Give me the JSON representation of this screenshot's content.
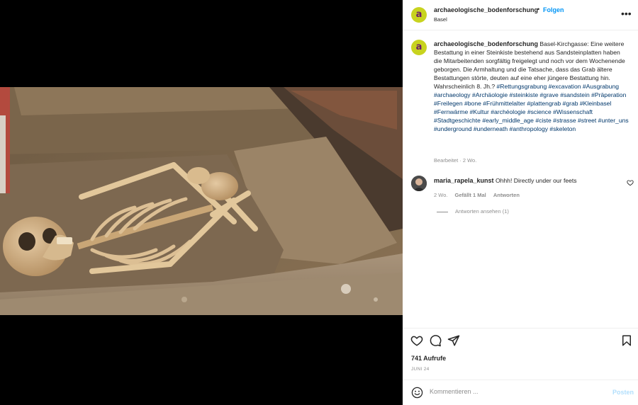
{
  "post": {
    "username": "archaeologische_bodenforschung",
    "avatar_letter": "a",
    "dot": "•",
    "follow_label": "Folgen",
    "location": "Basel",
    "more_label": "•••",
    "caption_text": "Basel-Kirchgasse: Eine weitere Bestattung in einer Steinkiste bestehend aus Sandsteinplatten haben die Mitarbeitenden sorgfältig freigelegt und noch vor dem Wochenende geborgen. Die Armhaltung und die Tatsache, dass das Grab ältere Bestattungen störte, deuten auf eine eher jüngere Bestattung hin. Wahrscheinlich 8. Jh.?",
    "hashtags": "#Rettungsgrabung #excavation #Ausgrabung #archaeology #Archäologie #steinkiste #grave #sandstein #Präperation #Freilegen #bone #Frühmittelalter #plattengrab #grab #Kleinbasel #Fernwärme #Kultur #archéologie #science #Wissenschaft #Stadtgeschichte #early_middle_age #ciste #strasse #street #unter_uns #underground #underneath #anthropology #skeleton",
    "edited_meta": "Bearbeitet · 2 Wo.",
    "views": "741 Aufrufe",
    "date": "JUNI 24"
  },
  "comment": {
    "username": "maria_rapela_kunst",
    "text": "Ohhh! Directly under our feets",
    "age": "2 Wo.",
    "likes": "Gefällt 1 Mal",
    "reply_label": "Antworten",
    "view_replies": "Antworten ansehen (1)"
  },
  "composer": {
    "placeholder": "Kommentieren ...",
    "post_label": "Posten"
  },
  "colors": {
    "accent": "#0095f6",
    "avatar_bg": "#c8d31f",
    "avatar_fg": "#6a1b6a",
    "hashtag": "#00376b"
  },
  "icons": [
    "heart-icon",
    "comment-icon",
    "share-icon",
    "bookmark-icon",
    "emoji-icon",
    "small-heart-icon"
  ]
}
